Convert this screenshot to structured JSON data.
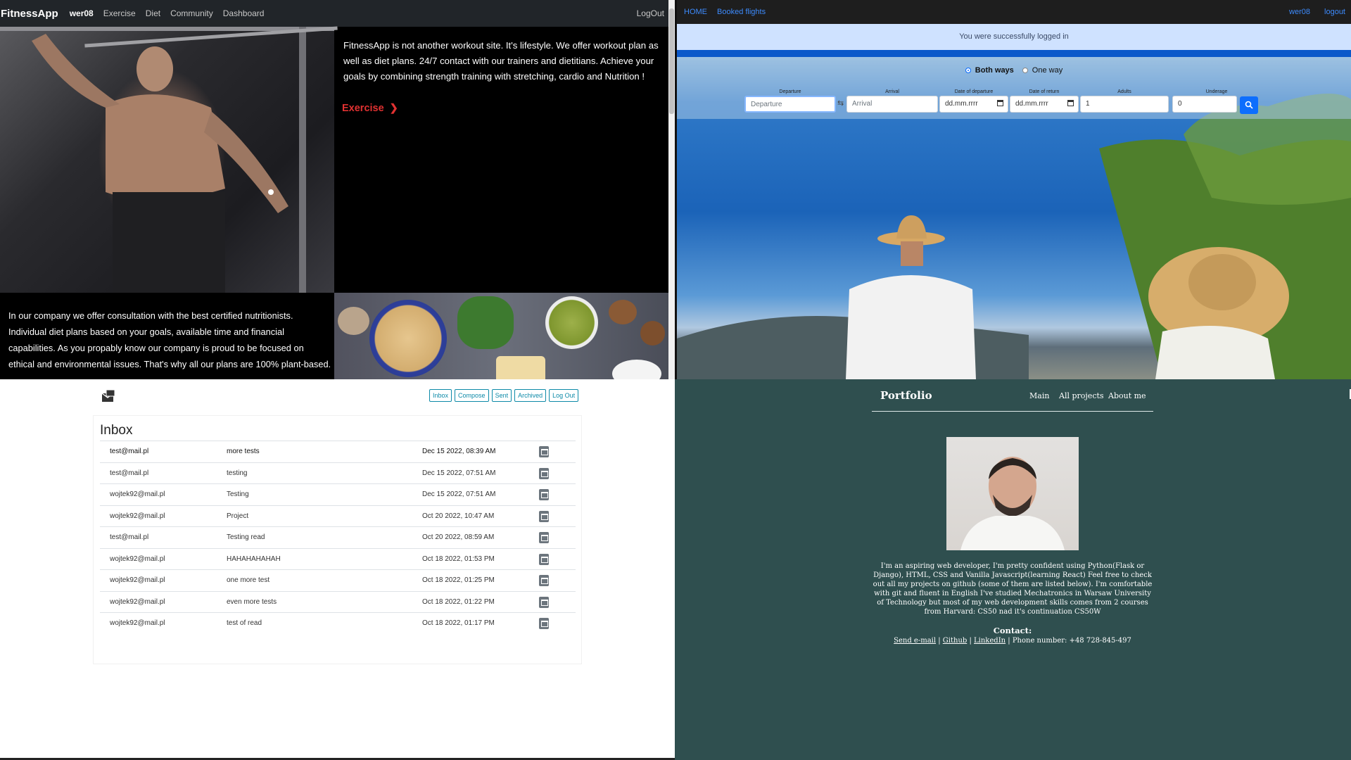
{
  "fitness": {
    "brand": "FitnessApp",
    "user": "wer08",
    "nav": [
      "Exercise",
      "Diet",
      "Community",
      "Dashboard"
    ],
    "logout": "LogOut",
    "hero_text": "FitnessApp is not another workout site. It's lifestyle. We offer workout plan as well as diet plans. 24/7 contact with our trainers and dietitians. Achieve your goals by combining strength training with stretching, cardio and Nutrition !",
    "exercise_link": "Exercise",
    "diet_text": "In our company we offer consultation with the best certified nutritionists. Individual diet plans based on your goals, available time and financial capabilities. As you propably know our company is proud to be focused on ethical and environmental issues. That's why all our plans are 100% plant-based.",
    "accent": "#e03131"
  },
  "flights": {
    "nav_left": [
      "HOME",
      "Booked flights"
    ],
    "user": "wer08",
    "logout": "logout",
    "alert": "You were successfully logged in",
    "trip_options": [
      "Both ways",
      "One way"
    ],
    "labels": {
      "departure": "Departure",
      "arrival": "Arrival",
      "date_departure": "Date of departure",
      "date_return": "Date of return",
      "adults": "Adults",
      "underage": "Underage"
    },
    "placeholders": {
      "departure": "Departure",
      "arrival": "Arrival",
      "date_departure": "dd.mm.rrrr",
      "date_return": "dd.mm.rrrr"
    },
    "values": {
      "adults": "1",
      "underage": "0"
    },
    "accent": "#0d6efd"
  },
  "inbox": {
    "buttons": [
      "Inbox",
      "Compose",
      "Sent",
      "Archived",
      "Log Out"
    ],
    "title": "Inbox",
    "emails": [
      {
        "from": "test@mail.pl",
        "subject": "more tests",
        "date": "Dec 15 2022, 08:39 AM"
      },
      {
        "from": "test@mail.pl",
        "subject": "testing",
        "date": "Dec 15 2022, 07:51 AM"
      },
      {
        "from": "wojtek92@mail.pl",
        "subject": "Testing",
        "date": "Dec 15 2022, 07:51 AM"
      },
      {
        "from": "wojtek92@mail.pl",
        "subject": "Project",
        "date": "Oct 20 2022, 10:47 AM"
      },
      {
        "from": "test@mail.pl",
        "subject": "Testing read",
        "date": "Oct 20 2022, 08:59 AM"
      },
      {
        "from": "wojtek92@mail.pl",
        "subject": "HAHAHAHAHAH",
        "date": "Oct 18 2022, 01:53 PM"
      },
      {
        "from": "wojtek92@mail.pl",
        "subject": "one more test",
        "date": "Oct 18 2022, 01:25 PM"
      },
      {
        "from": "wojtek92@mail.pl",
        "subject": "even more tests",
        "date": "Oct 18 2022, 01:22 PM"
      },
      {
        "from": "wojtek92@mail.pl",
        "subject": "test of read",
        "date": "Oct 18 2022, 01:17 PM"
      }
    ],
    "accent": "#0d8aa8"
  },
  "portfolio": {
    "brand": "Portfolio",
    "nav": [
      "Main",
      "All projects",
      "About me"
    ],
    "about": "I'm an aspiring web developer, I'm pretty confident using Python(Flask or Django), HTML, CSS and Vanilla Javascript(learning React) Feel free to check out all my projects on github (some of them are listed below). I'm comfortable with git and fluent in English I've studied Mechatronics in Warsaw University of Technology but most of my web development skills comes from 2 courses from Harvard: CS50 nad it's continuation CS50W",
    "contact_heading": "Contact:",
    "contact_links": [
      "Send e-mail",
      "Github",
      "LinkedIn"
    ],
    "phone": "Phone number: +48 728-845-497",
    "background": "#2f4f4f"
  }
}
